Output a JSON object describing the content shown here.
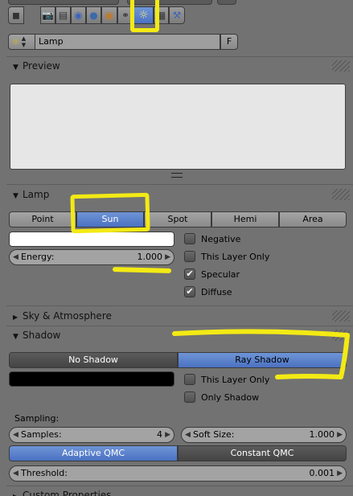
{
  "context_buttons": [
    {
      "icon": "camera-icon",
      "glyph": "📷"
    },
    {
      "icon": "render-layers-icon",
      "glyph": "▤"
    },
    {
      "icon": "scene-icon",
      "glyph": "◉"
    },
    {
      "icon": "world-icon",
      "glyph": "●"
    },
    {
      "icon": "object-icon",
      "glyph": "▣"
    },
    {
      "icon": "constraints-icon",
      "glyph": "⚭"
    },
    {
      "icon": "lamp-data-icon",
      "glyph": "☼"
    },
    {
      "icon": "texture-icon",
      "glyph": "▦"
    },
    {
      "icon": "physics-icon",
      "glyph": "⚒"
    }
  ],
  "datablock": {
    "name": "Lamp",
    "fake_user": "F",
    "icon": "lamp-icon"
  },
  "panels": {
    "preview": {
      "title": "Preview"
    },
    "lamp": {
      "title": "Lamp",
      "types": [
        "Point",
        "Sun",
        "Spot",
        "Hemi",
        "Area"
      ],
      "selected_type": "Sun",
      "color": "#ffffff",
      "energy": {
        "label": "Energy:",
        "value": "1.000"
      },
      "options": [
        {
          "label": "Negative",
          "checked": false
        },
        {
          "label": "This Layer Only",
          "checked": false
        },
        {
          "label": "Specular",
          "checked": true
        },
        {
          "label": "Diffuse",
          "checked": true
        }
      ]
    },
    "sky": {
      "title": "Sky & Atmosphere"
    },
    "shadow": {
      "title": "Shadow",
      "modes": [
        "No Shadow",
        "Ray Shadow"
      ],
      "selected_mode": "Ray Shadow",
      "color": "#000000",
      "options": [
        {
          "label": "This Layer Only",
          "checked": false
        },
        {
          "label": "Only Shadow",
          "checked": false
        }
      ],
      "sampling_label": "Sampling:",
      "samples": {
        "label": "Samples:",
        "value": "4"
      },
      "soft_size": {
        "label": "Soft Size:",
        "value": "1.000"
      },
      "methods": [
        "Adaptive QMC",
        "Constant QMC"
      ],
      "selected_method": "Adaptive QMC",
      "threshold": {
        "label": "Threshold:",
        "value": "0.001"
      }
    },
    "custom": {
      "title": "Custom Properties"
    }
  },
  "colors": {
    "selected": "#5680cc",
    "highlight": "#f3ea14",
    "panel": "#727272"
  }
}
